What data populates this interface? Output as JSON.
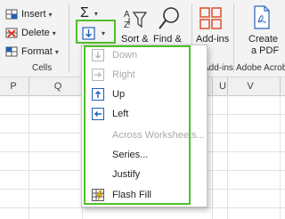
{
  "ribbon": {
    "cells_group": {
      "insert": "Insert",
      "delete": "Delete",
      "format": "Format",
      "label": "Cells"
    },
    "sigma": "Σ",
    "sort_filter": "Sort &",
    "find_select": "Find &",
    "addins": "Add-ins",
    "addins_group_label": "Add-ins",
    "create_pdf_line1": "Create",
    "create_pdf_line2": "a PDF",
    "acrobat_group_label": "Adobe Acrobat"
  },
  "grid": {
    "columns": [
      "P",
      "Q",
      "U",
      "V"
    ]
  },
  "fill_menu": {
    "items": [
      {
        "label": "Down",
        "enabled": false,
        "icon": "fill-down-icon"
      },
      {
        "label": "Right",
        "enabled": false,
        "icon": "fill-right-icon"
      },
      {
        "label": "Up",
        "enabled": true,
        "icon": "fill-up-icon"
      },
      {
        "label": "Left",
        "enabled": true,
        "icon": "fill-left-icon"
      },
      {
        "label": "Across Worksheets...",
        "enabled": false,
        "icon": ""
      },
      {
        "label": "Series...",
        "enabled": true,
        "icon": ""
      },
      {
        "label": "Justify",
        "enabled": true,
        "icon": ""
      },
      {
        "label": "Flash Fill",
        "enabled": true,
        "icon": "flash-fill-icon"
      }
    ]
  },
  "colors": {
    "highlight": "#4fc027",
    "fill_blue": "#1f5fb8",
    "addins_orange": "#e0573a",
    "disabled_text": "#a9a9a9"
  }
}
